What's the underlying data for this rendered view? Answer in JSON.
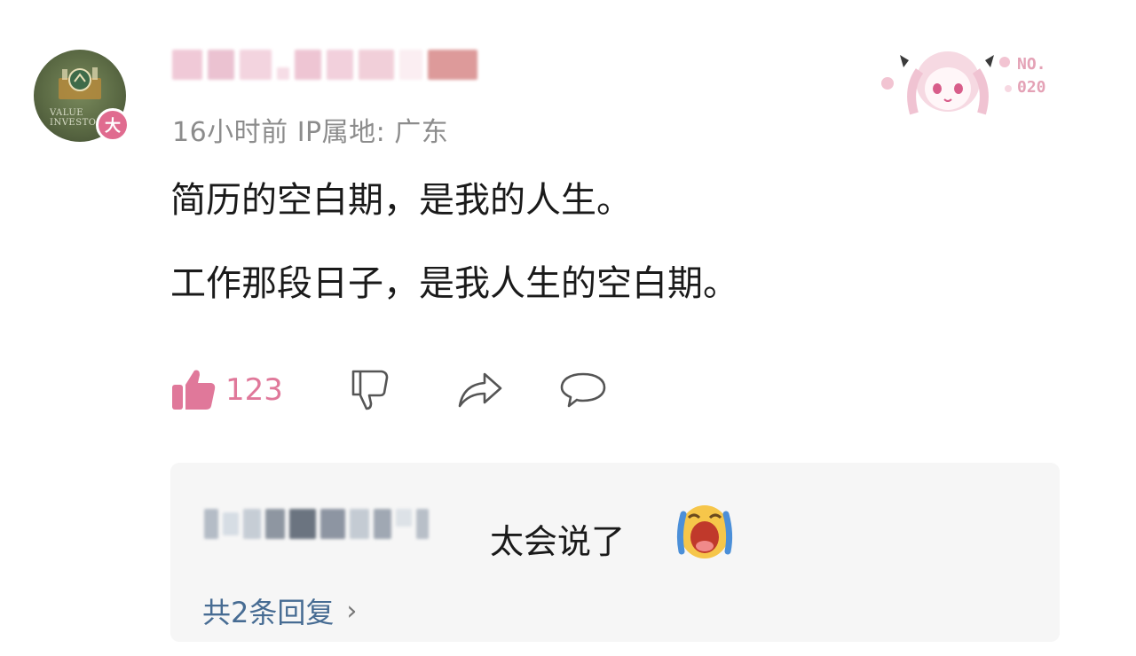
{
  "comment": {
    "meta": "16小时前  IP属地: 广东",
    "badge_label": "大",
    "avatar_text": [
      "VALUE",
      "INVESTO"
    ],
    "body_lines": [
      "简历的空白期，是我的人生。",
      "工作那段日子，是我人生的空白期。"
    ],
    "like_count": "123",
    "icons": [
      "thumbs-up-icon",
      "thumbs-down-icon",
      "share-icon",
      "comment-icon"
    ]
  },
  "sticker": {
    "text_line1": "NO.",
    "text_line2": "020"
  },
  "reply": {
    "text": "太会说了",
    "emoji": "crying-face-icon",
    "more_label": "共2条回复",
    "chevron": "›"
  },
  "colors": {
    "like_pink": "#e0789a",
    "meta_gray": "#8c8c8c",
    "link_blue": "#476c93",
    "panel_bg": "#f6f6f6"
  }
}
